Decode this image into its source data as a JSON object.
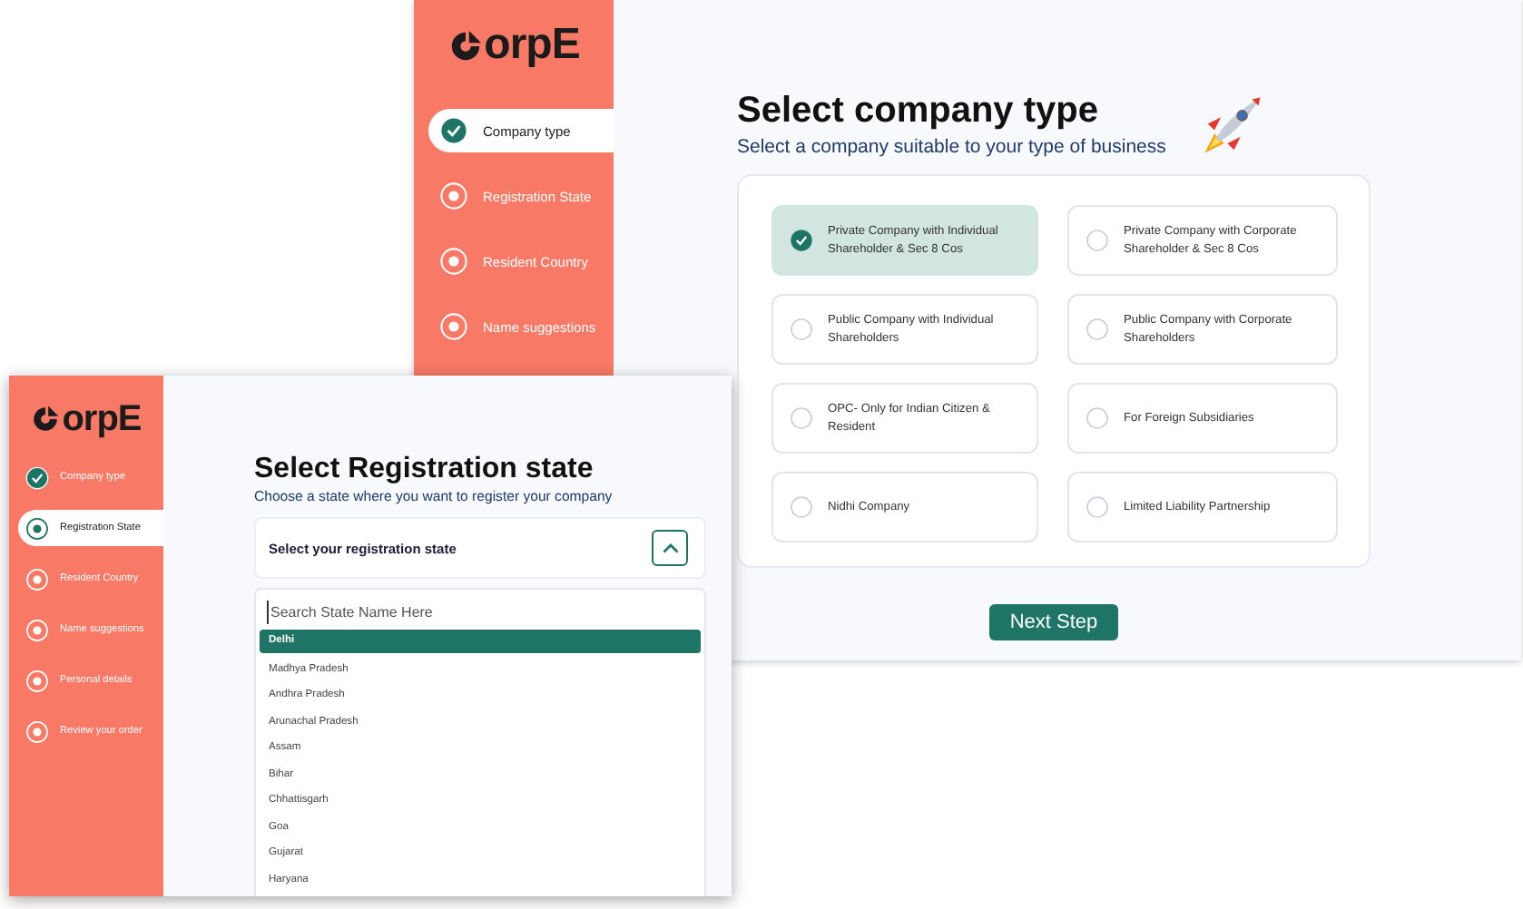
{
  "company_window": {
    "logo": "orpE",
    "steps": [
      {
        "label": "Company type",
        "done": true,
        "selected": true
      },
      {
        "label": "Registration State",
        "done": false,
        "selected": false
      },
      {
        "label": "Resident  Country",
        "done": false,
        "selected": false
      },
      {
        "label": "Name suggestions",
        "done": false,
        "selected": false
      }
    ],
    "title": "Select company type",
    "subtitle": "Select a company suitable to your type of business",
    "options": [
      {
        "label": "Private Company with Individual Shareholder & Sec 8 Cos",
        "selected": true
      },
      {
        "label": "Private Company with Corporate Shareholder & Sec 8 Cos",
        "selected": false
      },
      {
        "label": "Public Company with Individual Shareholders",
        "selected": false
      },
      {
        "label": "Public Company with Corporate Shareholders",
        "selected": false
      },
      {
        "label": "OPC- Only for Indian Citizen & Resident",
        "selected": false
      },
      {
        "label": "For Foreign Subsidiaries",
        "selected": false
      },
      {
        "label": "Nidhi Company",
        "selected": false
      },
      {
        "label": "Limited Liability Partnership",
        "selected": false
      }
    ],
    "next_button": "Next Step"
  },
  "state_window": {
    "logo": "orpE",
    "steps": [
      {
        "label": "Company type",
        "done": true,
        "selected": false
      },
      {
        "label": "Registration State",
        "done": false,
        "selected": true
      },
      {
        "label": "Resident  Country",
        "done": false,
        "selected": false
      },
      {
        "label": "Name suggestions",
        "done": false,
        "selected": false
      },
      {
        "label": "Personal details",
        "done": false,
        "selected": false
      },
      {
        "label": "Review your order",
        "done": false,
        "selected": false
      }
    ],
    "title": "Select Registration state",
    "subtitle": "Choose a state where you want to register your company",
    "dropdown": {
      "label": "Select your registration state",
      "expanded": true,
      "search_placeholder": "Search State Name Here",
      "states": [
        {
          "name": "Delhi",
          "selected": true
        },
        {
          "name": "Madhya Pradesh",
          "selected": false
        },
        {
          "name": "Andhra Pradesh",
          "selected": false
        },
        {
          "name": "Arunachal Pradesh",
          "selected": false
        },
        {
          "name": "Assam",
          "selected": false
        },
        {
          "name": "Bihar",
          "selected": false
        },
        {
          "name": "Chhattisgarh",
          "selected": false
        },
        {
          "name": "Goa",
          "selected": false
        },
        {
          "name": "Gujarat",
          "selected": false
        },
        {
          "name": "Haryana",
          "selected": false
        }
      ]
    }
  }
}
